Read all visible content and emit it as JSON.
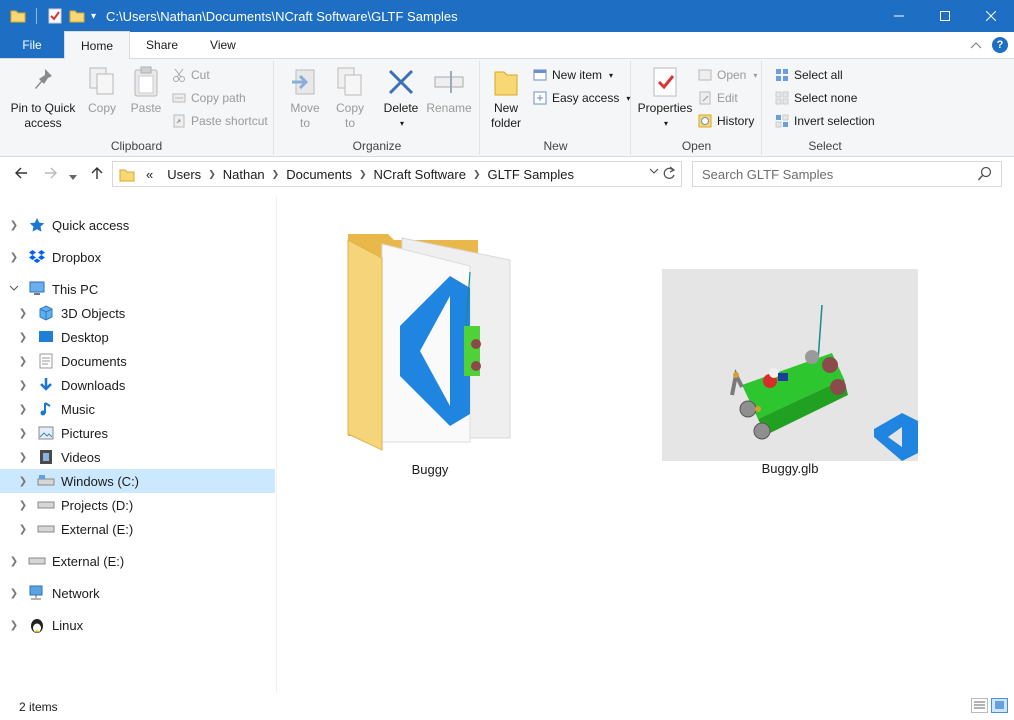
{
  "window": {
    "title_path": "C:\\Users\\Nathan\\Documents\\NCraft Software\\GLTF Samples",
    "minimize": "—",
    "maximize": "☐",
    "close": "✕"
  },
  "tabs": {
    "file": "File",
    "home": "Home",
    "share": "Share",
    "view": "View"
  },
  "ribbon": {
    "clipboard": {
      "label": "Clipboard",
      "pin_line1": "Pin to Quick",
      "pin_line2": "access",
      "copy": "Copy",
      "paste": "Paste",
      "cut": "Cut",
      "copy_path": "Copy path",
      "paste_shortcut": "Paste shortcut"
    },
    "organize": {
      "label": "Organize",
      "move_to_1": "Move",
      "move_to_2": "to",
      "copy_to_1": "Copy",
      "copy_to_2": "to",
      "delete": "Delete",
      "rename": "Rename"
    },
    "new": {
      "label": "New",
      "new_folder_1": "New",
      "new_folder_2": "folder",
      "new_item": "New item",
      "easy_access": "Easy access"
    },
    "open": {
      "label": "Open",
      "properties": "Properties",
      "open": "Open",
      "edit": "Edit",
      "history": "History"
    },
    "select": {
      "label": "Select",
      "select_all": "Select all",
      "select_none": "Select none",
      "invert_selection": "Invert selection"
    }
  },
  "address": {
    "overflow": "«",
    "segments": [
      "Users",
      "Nathan",
      "Documents",
      "NCraft Software",
      "GLTF Samples"
    ]
  },
  "search": {
    "placeholder": "Search GLTF Samples"
  },
  "nav": {
    "quick_access": "Quick access",
    "dropbox": "Dropbox",
    "this_pc": "This PC",
    "objects_3d": "3D Objects",
    "desktop": "Desktop",
    "documents": "Documents",
    "downloads": "Downloads",
    "music": "Music",
    "pictures": "Pictures",
    "videos": "Videos",
    "windows_c": "Windows (C:)",
    "projects_d": "Projects (D:)",
    "external_e_sub": "External (E:)",
    "external_e": "External (E:)",
    "network": "Network",
    "linux": "Linux"
  },
  "files": {
    "folder_name": "Buggy",
    "glb_name": "Buggy.glb"
  },
  "status": {
    "count": "2 items"
  },
  "colors": {
    "titlebar": "#1e6fc4",
    "selection": "#cce8ff",
    "ribbon_bg": "#f5f6f7"
  }
}
